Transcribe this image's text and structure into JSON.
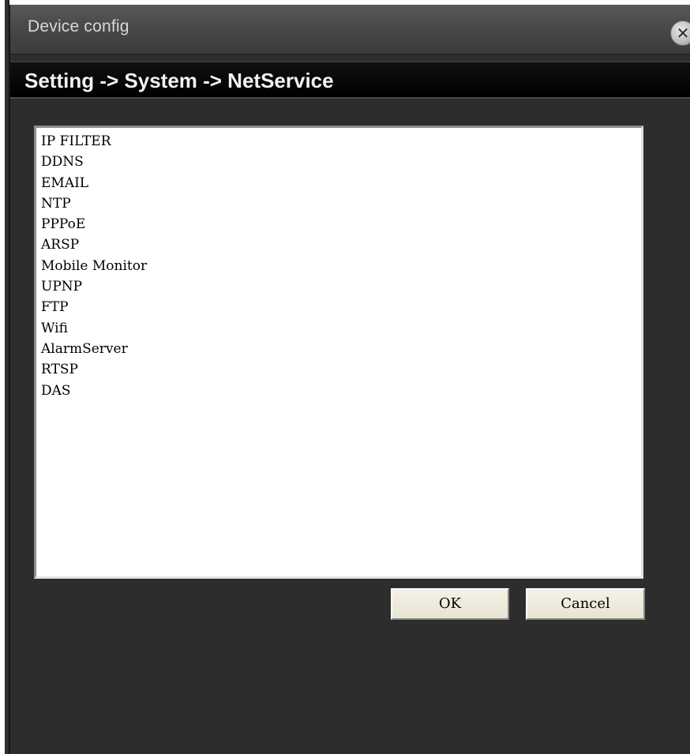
{
  "window": {
    "title": "Device config",
    "close_icon": "close-icon",
    "close_glyph": "✕"
  },
  "breadcrumb": {
    "text": "Setting -> System -> NetService"
  },
  "services": {
    "items": [
      "IP FILTER",
      "DDNS",
      "EMAIL",
      "NTP",
      "PPPoE",
      "ARSP",
      "Mobile Monitor",
      "UPNP",
      "FTP",
      "Wifi",
      "AlarmServer",
      "RTSP",
      "DAS"
    ]
  },
  "buttons": {
    "ok_label": "OK",
    "cancel_label": "Cancel"
  },
  "colors": {
    "window_bg": "#2d2d2d",
    "titlebar": "#4a4a4a",
    "breadcrumb_bar": "#000000",
    "list_bg": "#ffffff",
    "button_bg": "#ece8d8"
  }
}
